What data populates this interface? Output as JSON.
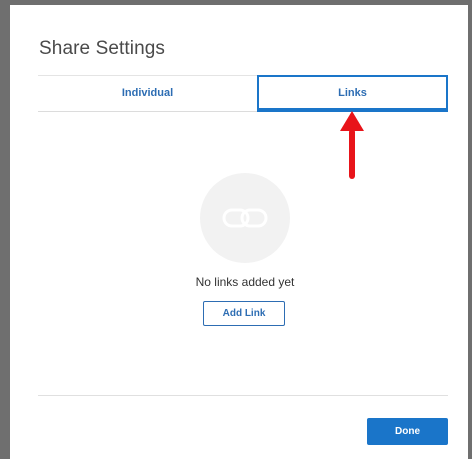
{
  "dialog": {
    "title": "Share Settings"
  },
  "tabs": [
    {
      "label": "Individual",
      "active": false
    },
    {
      "label": "Links",
      "active": true
    }
  ],
  "empty_state": {
    "icon": "link-icon",
    "message": "No links added yet",
    "add_button_label": "Add Link"
  },
  "footer": {
    "done_label": "Done"
  },
  "annotation": {
    "icon": "red-arrow-up",
    "color": "#e8141a"
  },
  "colors": {
    "accent": "#1a75c9",
    "tab_text": "#2d6db3",
    "frame": "#6f6f6f"
  }
}
